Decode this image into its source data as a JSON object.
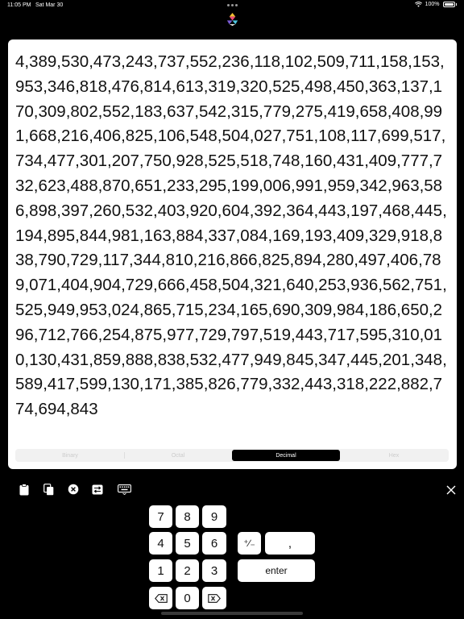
{
  "status_bar": {
    "time": "11:05 PM",
    "date": "Sat Mar 30",
    "battery": "100%"
  },
  "display": {
    "value": "4,389,530,473,243,737,552,236,118,102,509,711,158,153,953,346,818,476,814,613,319,320,525,498,450,363,137,170,309,802,552,183,637,542,315,779,275,419,658,408,991,668,216,406,825,106,548,504,027,751,108,117,699,517,734,477,301,207,750,928,525,518,748,160,431,409,777,732,623,488,870,651,233,295,199,006,991,959,342,963,586,898,397,260,532,403,920,604,392,364,443,197,468,445,194,895,844,981,163,884,337,084,169,193,409,329,918,838,790,729,117,344,810,216,866,825,894,280,497,406,789,071,404,904,729,666,458,504,321,640,253,936,562,751,525,949,953,024,865,715,234,165,690,309,984,186,650,296,712,766,254,875,977,729,797,519,443,717,595,310,010,130,431,859,888,838,532,477,949,845,347,445,201,348,589,417,599,130,171,385,826,779,332,443,318,222,882,774,694,843"
  },
  "base_selector": {
    "options": [
      "Binary",
      "Octal",
      "Decimal",
      "Hex"
    ],
    "selected": "Decimal"
  },
  "toolbar": {
    "icons": [
      "clipboard-icon",
      "copy-icon",
      "clear-icon",
      "swap-icon",
      "keyboard-icon"
    ],
    "close_icon": "close-icon"
  },
  "keypad": {
    "k7": "7",
    "k8": "8",
    "k9": "9",
    "k4": "4",
    "k5": "5",
    "k6": "6",
    "k1": "1",
    "k2": "2",
    "k3": "3",
    "k0": "0",
    "sign": "⁺∕₋",
    "comma": ",",
    "enter": "enter",
    "backspace_icon": "backspace-icon",
    "forward_delete_icon": "forward-delete-icon"
  },
  "colors": {
    "background": "#000000",
    "card": "#ffffff",
    "key": "#ffffff",
    "segment_selected": "#000000"
  }
}
